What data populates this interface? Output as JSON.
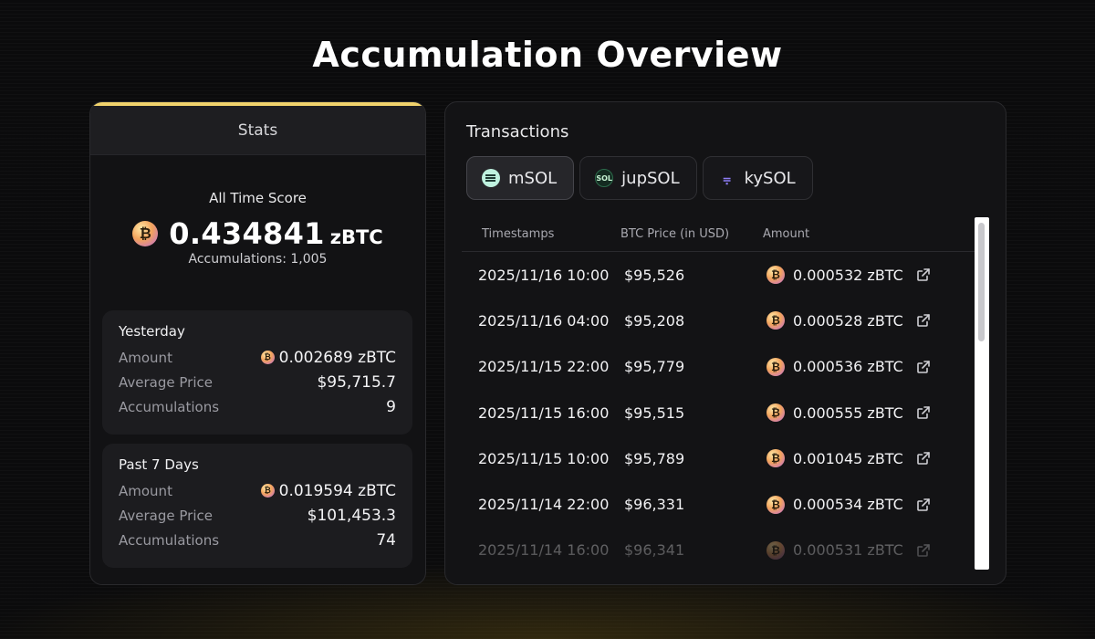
{
  "page": {
    "title": "Accumulation Overview"
  },
  "stats": {
    "header": "Stats",
    "all_time_label": "All Time Score",
    "score_value": "0.434841",
    "score_unit": "zBTC",
    "accumulations_text": "Accumulations: 1,005",
    "coin_icon": "zbtc-coin-icon",
    "yesterday": {
      "title": "Yesterday",
      "amount_label": "Amount",
      "amount_value": "0.002689 zBTC",
      "avg_label": "Average Price",
      "avg_value": "$95,715.7",
      "acc_label": "Accumulations",
      "acc_value": "9"
    },
    "week": {
      "title": "Past 7 Days",
      "amount_label": "Amount",
      "amount_value": "0.019594 zBTC",
      "avg_label": "Average Price",
      "avg_value": "$101,453.3",
      "acc_label": "Accumulations",
      "acc_value": "74"
    }
  },
  "transactions": {
    "title": "Transactions",
    "tabs": [
      {
        "label": "mSOL",
        "icon": "msol-icon",
        "active": true
      },
      {
        "label": "jupSOL",
        "icon": "jupsol-icon",
        "icon_text": "SOL",
        "active": false
      },
      {
        "label": "kySOL",
        "icon": "kysol-icon",
        "icon_text": "⩦",
        "active": false
      }
    ],
    "columns": [
      "Timestamps",
      "BTC Price (in USD)",
      "Amount"
    ],
    "rows": [
      {
        "timestamp": "2025/11/16 10:00",
        "price": "$95,526",
        "amount": "0.000532 zBTC"
      },
      {
        "timestamp": "2025/11/16 04:00",
        "price": "$95,208",
        "amount": "0.000528 zBTC"
      },
      {
        "timestamp": "2025/11/15 22:00",
        "price": "$95,779",
        "amount": "0.000536 zBTC"
      },
      {
        "timestamp": "2025/11/15 16:00",
        "price": "$95,515",
        "amount": "0.000555 zBTC"
      },
      {
        "timestamp": "2025/11/15 10:00",
        "price": "$95,789",
        "amount": "0.001045 zBTC"
      },
      {
        "timestamp": "2025/11/14 22:00",
        "price": "$96,331",
        "amount": "0.000534 zBTC"
      },
      {
        "timestamp": "2025/11/14 16:00",
        "price": "$96,341",
        "amount": "0.000531 zBTC"
      }
    ]
  },
  "colors": {
    "accent": "#f1d36c",
    "card_bg": "#121214",
    "page_bg": "#0b0b0c"
  }
}
